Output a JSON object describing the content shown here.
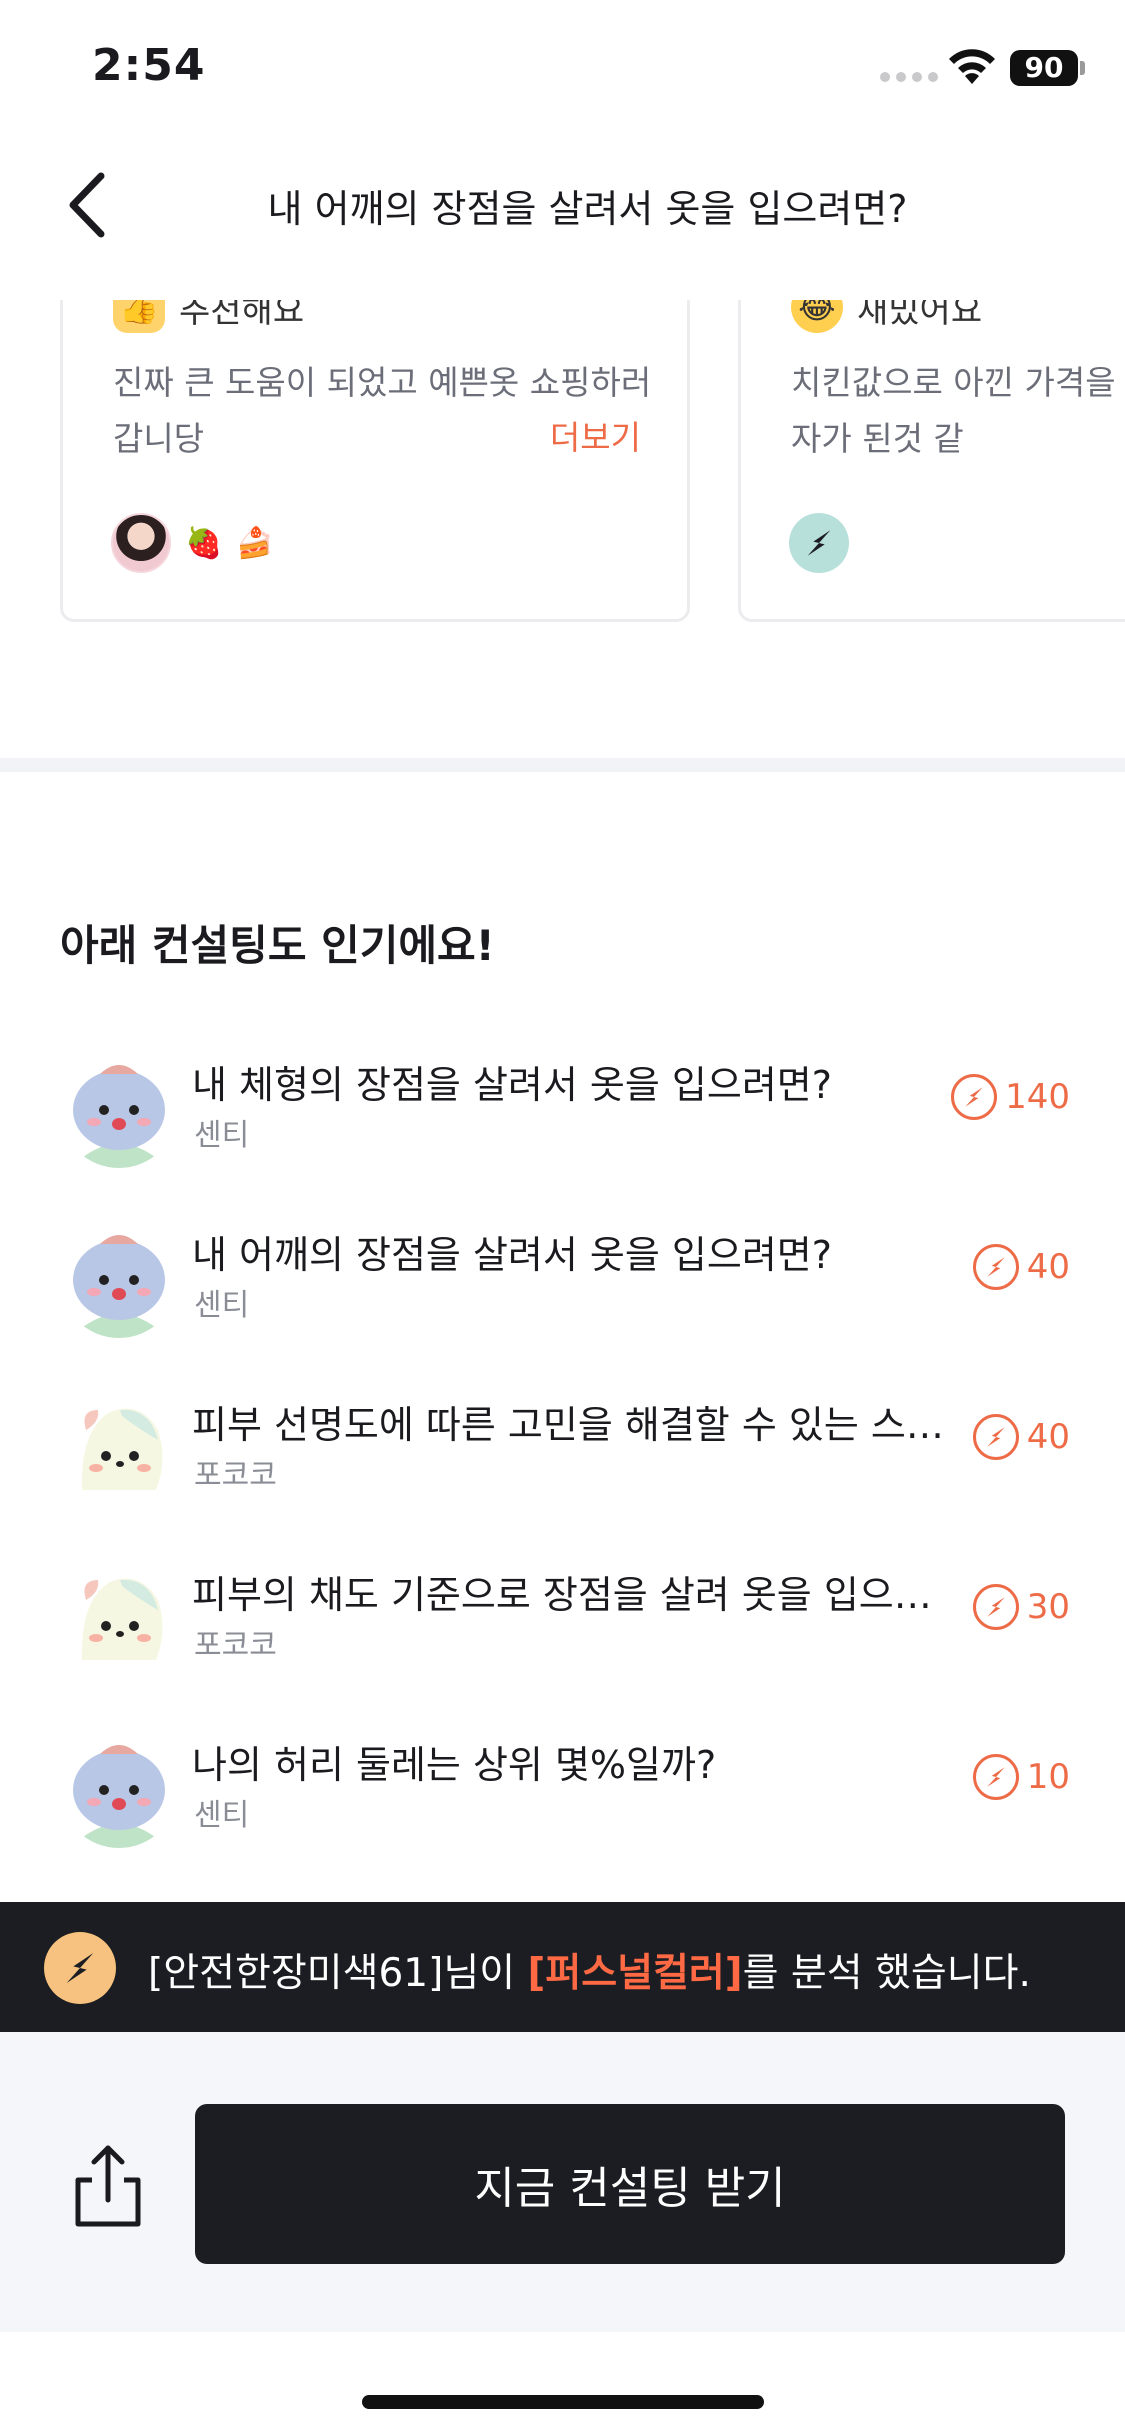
{
  "status_bar": {
    "time": "2:54",
    "battery": "90"
  },
  "nav": {
    "title": "내 어깨의 장점을 살려서 옷을 입으려면?"
  },
  "reviews": [
    {
      "tag": "추천해요",
      "text": "진짜 큰 도움이 되었고 예쁜옷 쇼핑하러갑니당",
      "more": "더보기",
      "icon": "thumbs-up-icon"
    },
    {
      "tag": "재밌어요",
      "text": "치킨값으로 아낀 가격을 해 똑똑한 소비자가 된것 같",
      "icon": "laughing-emoji-icon"
    }
  ],
  "section": {
    "title": "아래 컨설팅도 인기에요!"
  },
  "consultings": [
    {
      "title": "내 체형의 장점을 살려서 옷을 입으려면?",
      "author": "센티",
      "count": "140",
      "character": "senti"
    },
    {
      "title": "내 어깨의 장점을 살려서 옷을 입으려면?",
      "author": "센티",
      "count": "40",
      "character": "senti"
    },
    {
      "title": "피부 선명도에 따른 고민을 해결할 수 있는 스…",
      "author": "포코코",
      "count": "40",
      "character": "pokoko"
    },
    {
      "title": "피부의 채도 기준으로 장점을 살려 옷을 입으…",
      "author": "포코코",
      "count": "30",
      "character": "pokoko"
    },
    {
      "title": "나의 허리 둘레는 상위 몇%일까?",
      "author": "센티",
      "count": "10",
      "character": "senti"
    }
  ],
  "activity": {
    "prefix": "[안전한장미색61]님이 ",
    "highlight": "[퍼스널컬러]",
    "suffix": "를 분석 했습니다."
  },
  "actions": {
    "cta_label": "지금 컨설팅 받기"
  },
  "colors": {
    "accent": "#ee6b47",
    "dark": "#1c1d22",
    "muted": "#8a8d96"
  }
}
